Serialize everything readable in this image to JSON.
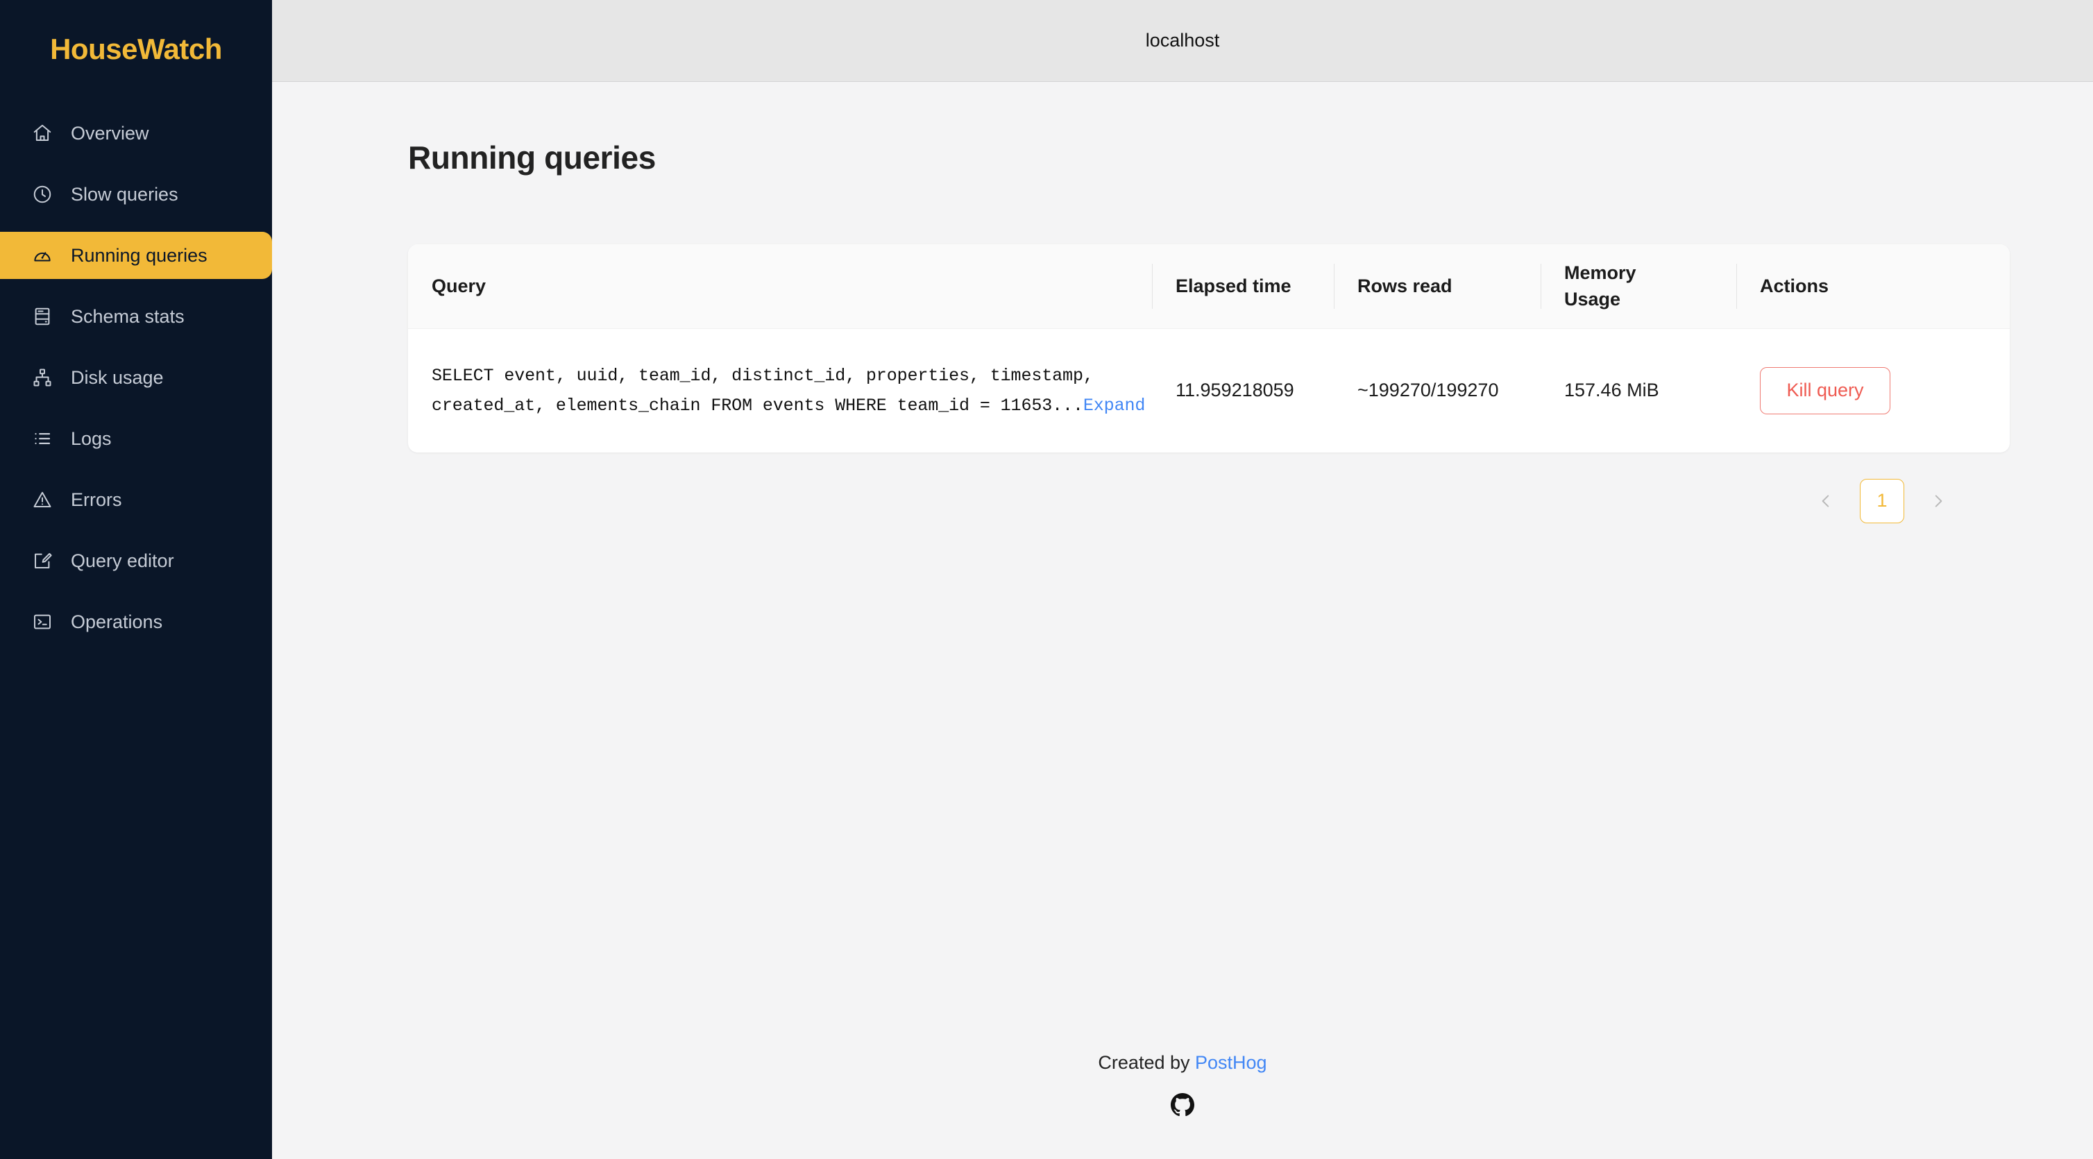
{
  "app": {
    "logo": "HouseWatch",
    "accent_color": "#f2b938",
    "sidebar_bg": "#0a1628"
  },
  "sidebar": {
    "items": [
      {
        "label": "Overview",
        "icon": "home-icon",
        "active": false
      },
      {
        "label": "Slow queries",
        "icon": "clock-icon",
        "active": false
      },
      {
        "label": "Running queries",
        "icon": "gauge-icon",
        "active": true
      },
      {
        "label": "Schema stats",
        "icon": "server-icon",
        "active": false
      },
      {
        "label": "Disk usage",
        "icon": "sitemap-icon",
        "active": false
      },
      {
        "label": "Logs",
        "icon": "list-icon",
        "active": false
      },
      {
        "label": "Errors",
        "icon": "warning-icon",
        "active": false
      },
      {
        "label": "Query editor",
        "icon": "edit-icon",
        "active": false
      },
      {
        "label": "Operations",
        "icon": "terminal-icon",
        "active": false
      }
    ]
  },
  "topbar": {
    "host": "localhost"
  },
  "page": {
    "title": "Running queries"
  },
  "table": {
    "columns": {
      "query": "Query",
      "elapsed": "Elapsed time",
      "memory_line1": "Memory",
      "memory_line2": "Usage",
      "rows": "Rows read",
      "actions": "Actions"
    },
    "rows": [
      {
        "query_line1": "SELECT event, uuid, team_id, distinct_id, properties, timestamp,",
        "query_line2": "created_at, elements_chain FROM events WHERE team_id = 11653...",
        "expand_label": "Expand",
        "elapsed": "11.959218059",
        "rows_read": "~199270/199270",
        "memory": "157.46 MiB",
        "action_label": "Kill query",
        "action_color": "#ef5b52"
      }
    ]
  },
  "pagination": {
    "prev": "‹",
    "next": "›",
    "current_page": "1"
  },
  "footer": {
    "prefix": "Created by ",
    "link_label": "PostHog",
    "link_color": "#4287f5",
    "github_icon": "github-icon"
  }
}
